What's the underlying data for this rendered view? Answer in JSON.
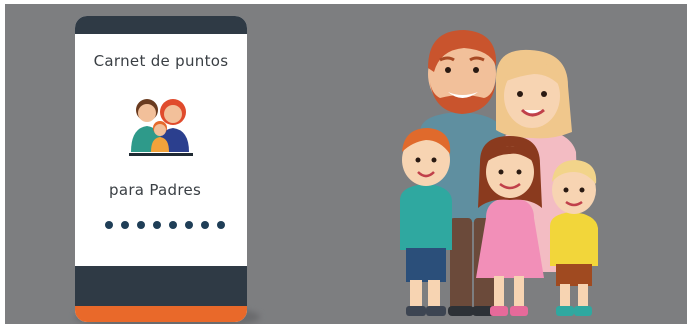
{
  "card": {
    "title": "Carnet de puntos",
    "subtitle": "para Padres",
    "pin_dots": 8
  },
  "colors": {
    "background": "#7d7e80",
    "phone_dark": "#2f3a45",
    "phone_accent": "#e9692a",
    "pin_dot": "#1f3e57"
  },
  "icons": {
    "card_illustration": "family-icon",
    "main_illustration": "family-illustration"
  }
}
